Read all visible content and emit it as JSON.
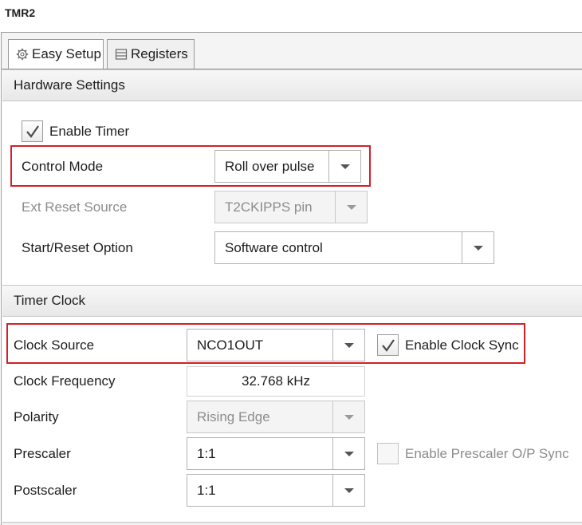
{
  "window": {
    "title": "TMR2"
  },
  "tabs": [
    {
      "label": "Easy Setup",
      "icon": "gear-icon",
      "active": true
    },
    {
      "label": "Registers",
      "icon": "list-icon",
      "active": false
    }
  ],
  "hardware_settings": {
    "title": "Hardware Settings",
    "enable_timer": {
      "label": "Enable Timer",
      "checked": true
    },
    "control_mode": {
      "label": "Control Mode",
      "value": "Roll over pulse"
    },
    "ext_reset_source": {
      "label": "Ext Reset Source",
      "value": "T2CKIPPS pin",
      "enabled": false
    },
    "start_reset_option": {
      "label": "Start/Reset Option",
      "value": "Software control"
    }
  },
  "timer_clock": {
    "title": "Timer Clock",
    "clock_source": {
      "label": "Clock Source",
      "value": "NCO1OUT"
    },
    "enable_clock_sync": {
      "label": "Enable Clock Sync",
      "checked": true
    },
    "clock_frequency": {
      "label": "Clock Frequency",
      "value": "32.768 kHz"
    },
    "polarity": {
      "label": "Polarity",
      "value": "Rising Edge",
      "enabled": false
    },
    "prescaler": {
      "label": "Prescaler",
      "value": "1:1"
    },
    "enable_prescaler_sync": {
      "label": "Enable Prescaler O/P Sync",
      "checked": false,
      "enabled": false
    },
    "postscaler": {
      "label": "Postscaler",
      "value": "1:1"
    }
  },
  "colors": {
    "highlight": "#d3202a",
    "disabled_text": "#8c8c8c"
  }
}
